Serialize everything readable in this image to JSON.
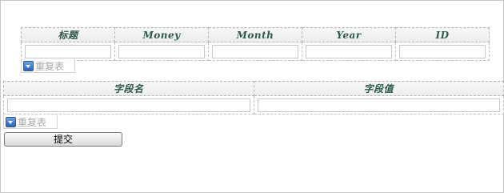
{
  "main_table": {
    "headers": [
      "标题",
      "Money",
      "Month",
      "Year",
      "ID"
    ],
    "row": [
      "",
      "",
      "",
      "",
      ""
    ]
  },
  "main_repeat_label": "重复表",
  "fields_table": {
    "headers": [
      "字段名",
      "字段值"
    ],
    "row": [
      "",
      ""
    ]
  },
  "fields_repeat_label": "重复表",
  "submit_label": "提交",
  "icons": {
    "repeat_dropdown": "chevron-down-icon"
  },
  "colors": {
    "header_text": "#2d5a4a",
    "header_bg": "#f0f0f0",
    "dropdown_icon": "#2a66c0",
    "repeat_label": "#a9a9a9"
  }
}
